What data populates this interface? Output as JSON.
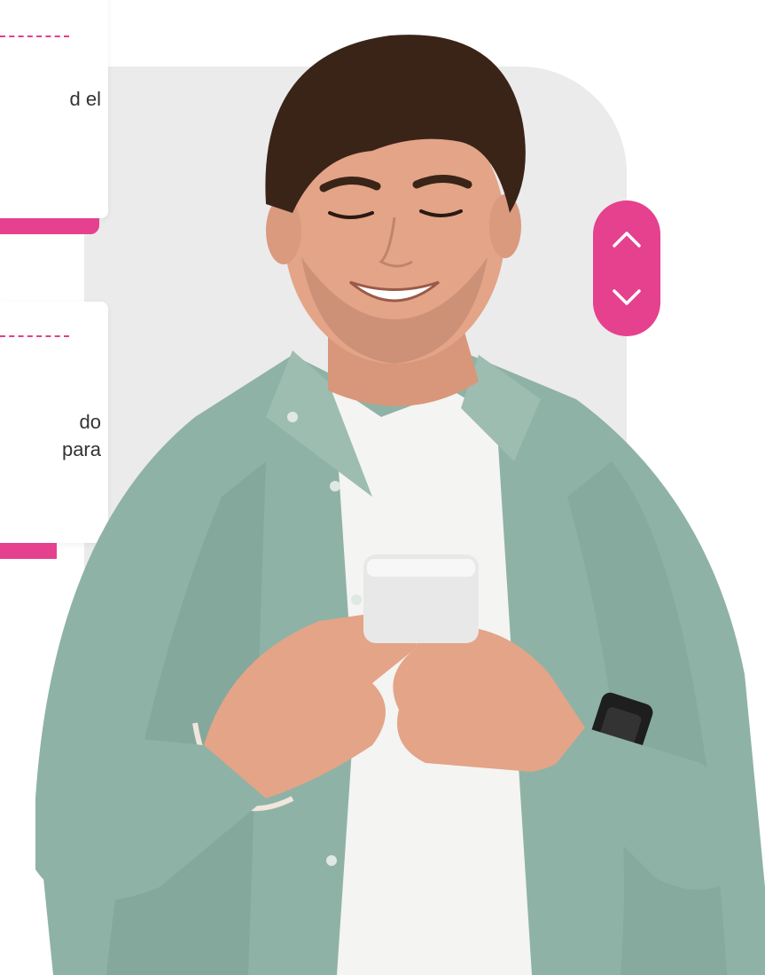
{
  "cards": [
    {
      "text": "d el"
    },
    {
      "text": "do\npara"
    }
  ],
  "scroll_control": {
    "up_icon": "chevron-up-icon",
    "down_icon": "chevron-down-icon"
  },
  "colors": {
    "accent": "#e5418f",
    "panel_gray": "#ebebeb",
    "text": "#333333",
    "shirt": "#8fb2a6",
    "tshirt": "#f4f4f2",
    "skin": "#e3a488",
    "hair": "#3a2418"
  }
}
